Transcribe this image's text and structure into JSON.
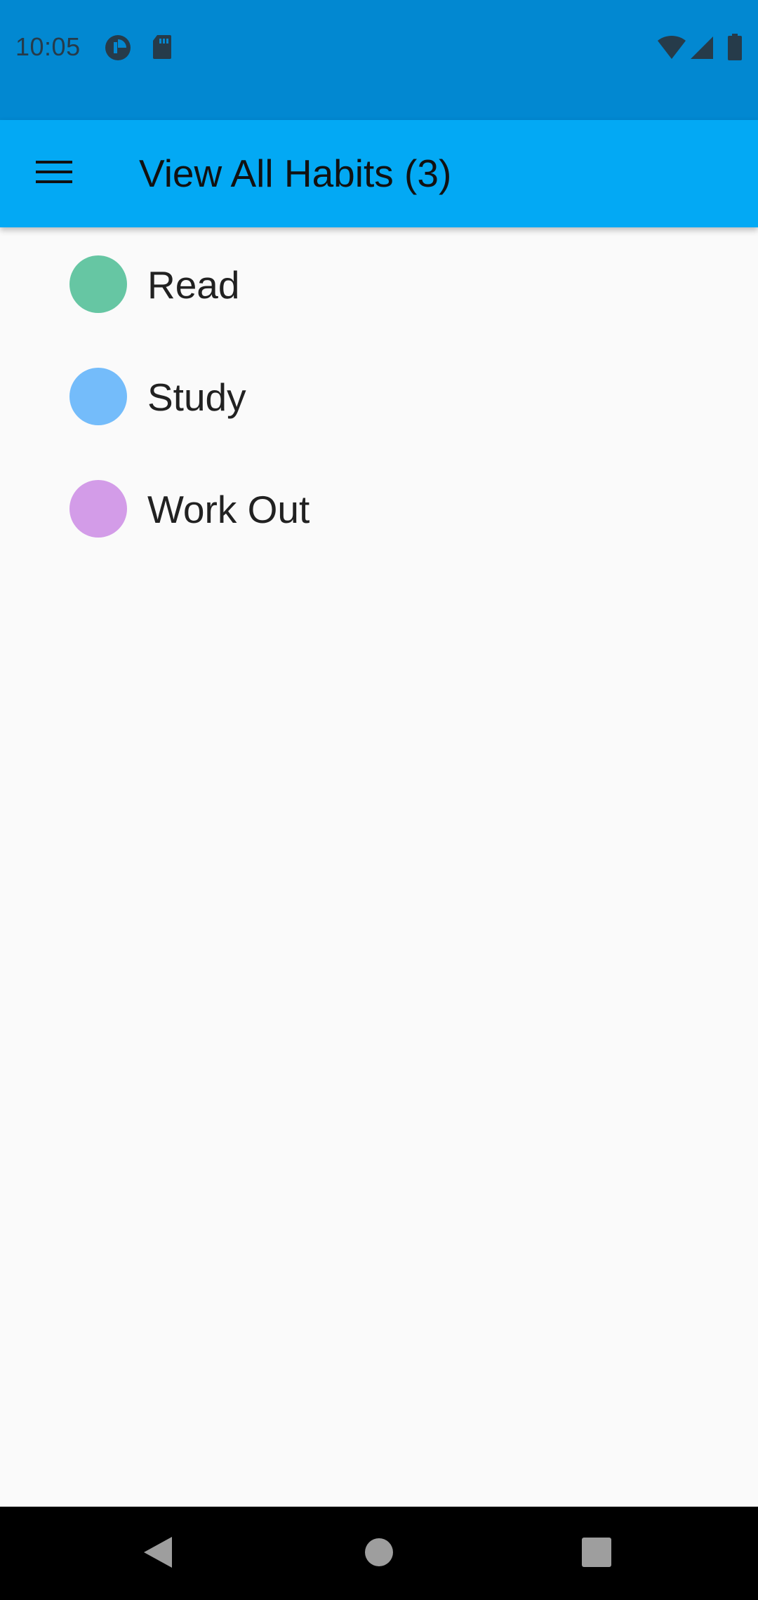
{
  "status_bar": {
    "time": "10:05",
    "left_icons": [
      "data-saver-icon",
      "sd-card-icon"
    ],
    "right_icons": [
      "wifi-icon",
      "cell-signal-icon",
      "battery-icon"
    ],
    "background_color": "#0288D1"
  },
  "app_bar": {
    "title": "View All Habits (3)",
    "menu_icon": "hamburger-menu-icon",
    "background_color": "#03A9F4"
  },
  "habits": [
    {
      "name": "Read",
      "color": "#66C6A3"
    },
    {
      "name": "Study",
      "color": "#74BCFA"
    },
    {
      "name": "Work Out",
      "color": "#D39CE8"
    }
  ],
  "nav_bar": {
    "buttons": [
      "back-icon",
      "home-icon",
      "recents-icon"
    ]
  }
}
